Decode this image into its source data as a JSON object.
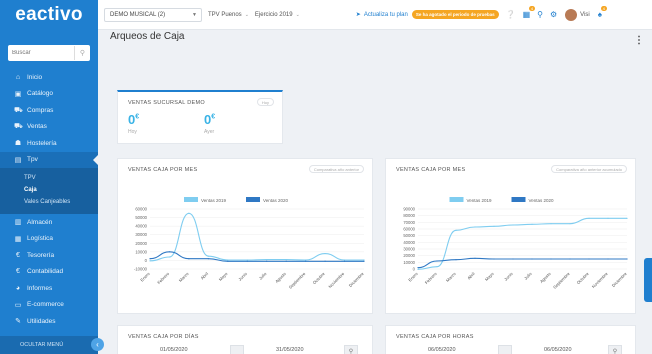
{
  "app": {
    "brand": "eactivo"
  },
  "sidebar": {
    "search_placeholder": "Buscar",
    "items": [
      {
        "label": "Inicio",
        "icon": "home-icon",
        "glyph": "⌂"
      },
      {
        "label": "Catálogo",
        "icon": "catalog-icon",
        "glyph": "▣"
      },
      {
        "label": "Compras",
        "icon": "purchases-icon",
        "glyph": "⛟"
      },
      {
        "label": "Ventas",
        "icon": "sales-icon",
        "glyph": "⛟"
      },
      {
        "label": "Hostelería",
        "icon": "hospitality-icon",
        "glyph": "☗"
      },
      {
        "label": "Tpv",
        "icon": "tpv-icon",
        "glyph": "▤"
      }
    ],
    "sub_items": [
      "TPV",
      "Caja",
      "Vales Canjeables"
    ],
    "items_after": [
      {
        "label": "Almacén",
        "icon": "warehouse-icon",
        "glyph": "▥"
      },
      {
        "label": "Logística",
        "icon": "logistics-icon",
        "glyph": "▦"
      },
      {
        "label": "Tesorería",
        "icon": "treasury-icon",
        "glyph": "€"
      },
      {
        "label": "Contabilidad",
        "icon": "accounting-icon",
        "glyph": "€"
      },
      {
        "label": "Informes",
        "icon": "reports-icon",
        "glyph": "◕"
      },
      {
        "label": "E-commerce",
        "icon": "ecommerce-icon",
        "glyph": "▭"
      },
      {
        "label": "Utilidades",
        "icon": "utilities-icon",
        "glyph": "✎"
      }
    ],
    "footer": "OCULTAR MENÚ"
  },
  "topbar": {
    "company": "DEMO MUSICAL (2)",
    "tpv": "TPV Puenos",
    "exercise": "Ejercicio 2019",
    "update_label": "Actualiza tu plan",
    "trial_badge": "Se ha agotado el periodo de pruebas",
    "notif_count": "4",
    "user": "Visi",
    "bell_count": "4"
  },
  "page": {
    "title": "Arqueos de Caja"
  },
  "kpi": {
    "title": "VENTAS SUCURSAL DEMO",
    "button": "Hoy",
    "values": [
      {
        "value": "0",
        "unit": "€",
        "label": "Hoy"
      },
      {
        "value": "0",
        "unit": "€",
        "label": "Ayer"
      }
    ]
  },
  "chart_panels": [
    {
      "title": "VENTAS CAJA POR MES",
      "button": "Comparativa año anterior"
    },
    {
      "title": "VENTAS CAJA POR MES",
      "button": "Comparativa año anterior acumulado"
    }
  ],
  "chart_data": [
    {
      "type": "line",
      "title": "",
      "categories": [
        "Enero",
        "Febrero",
        "Marzo",
        "Abril",
        "Mayo",
        "Junio",
        "Julio",
        "Agosto",
        "Septiembre",
        "Octubre",
        "Noviembre",
        "Diciembre"
      ],
      "series": [
        {
          "name": "Ventas 2019",
          "color": "#7fcdf0",
          "values": [
            -500,
            4000,
            55000,
            5000,
            500,
            500,
            1000,
            1000,
            500,
            8000,
            500,
            500
          ]
        },
        {
          "name": "Ventas 2020",
          "color": "#2f78c4",
          "values": [
            2000,
            10000,
            2000,
            2000,
            -1000,
            -1000,
            -1000,
            -1000,
            -1000,
            -1000,
            -1000,
            -1000
          ]
        }
      ],
      "yticks": [
        -10000,
        0,
        10000,
        20000,
        30000,
        40000,
        50000,
        60000
      ],
      "ylim": [
        -10000,
        60000
      ],
      "legend": "top"
    },
    {
      "type": "line",
      "title": "",
      "categories": [
        "Enero",
        "Febrero",
        "Marzo",
        "Abril",
        "Mayo",
        "Junio",
        "Julio",
        "Agosto",
        "Septiembre",
        "Octubre",
        "Noviembre",
        "Diciembre"
      ],
      "series": [
        {
          "name": "Ventas 2019",
          "color": "#7fcdf0",
          "values": [
            -500,
            3500,
            58000,
            63000,
            64000,
            66000,
            67000,
            68000,
            68000,
            76000,
            76000,
            76000
          ]
        },
        {
          "name": "Ventas 2020",
          "color": "#2f78c4",
          "values": [
            2000,
            12000,
            14000,
            16000,
            15000,
            15000,
            15000,
            15000,
            15000,
            15000,
            15000,
            15000
          ]
        }
      ],
      "yticks": [
        0,
        10000,
        20000,
        30000,
        40000,
        50000,
        60000,
        70000,
        80000,
        90000
      ],
      "ylim": [
        0,
        90000
      ],
      "legend": "top"
    }
  ],
  "days": {
    "title": "VENTAS CAJA POR DÍAS",
    "from": "01/05/2020",
    "to": "31/05/2020"
  },
  "hours": {
    "title": "VENTAS CAJA POR HORAS",
    "from": "06/05/2020",
    "to": "06/05/2020"
  }
}
